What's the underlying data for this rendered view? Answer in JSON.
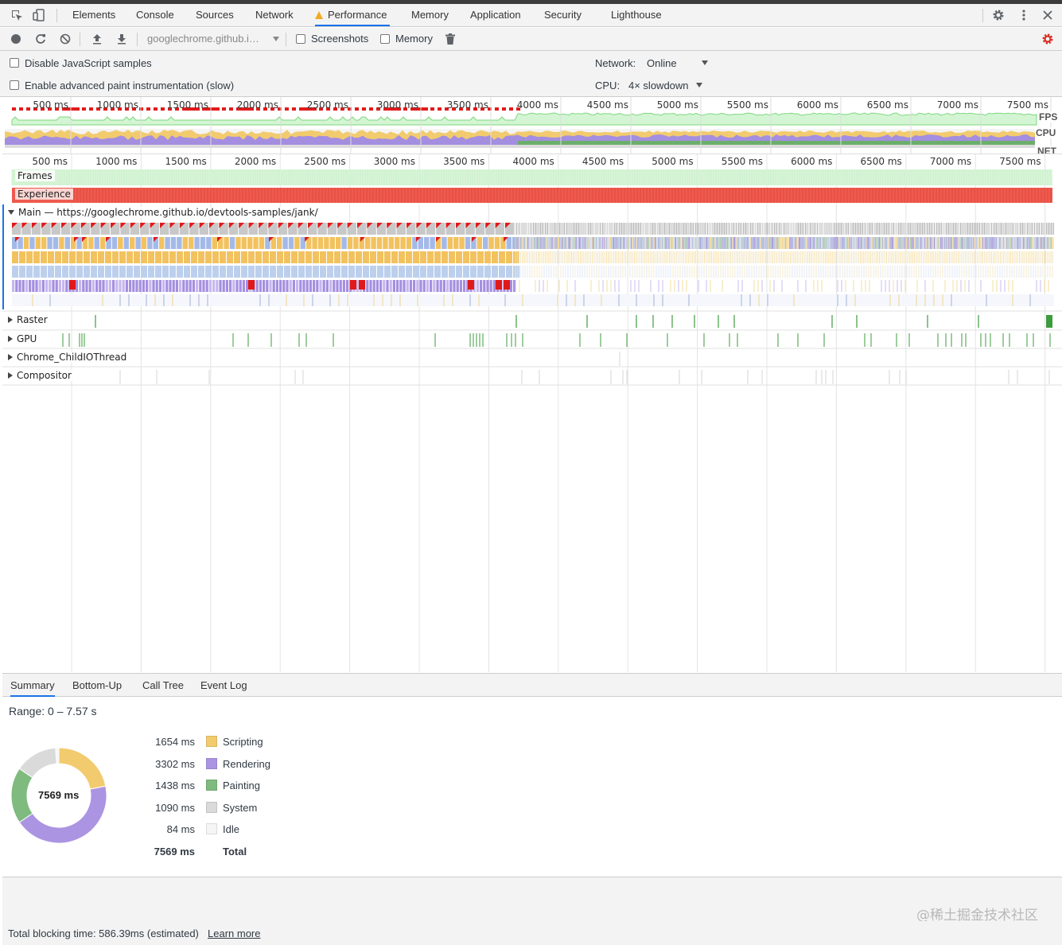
{
  "tabs": [
    {
      "label": "Elements"
    },
    {
      "label": "Console"
    },
    {
      "label": "Sources"
    },
    {
      "label": "Network"
    },
    {
      "label": "Performance"
    },
    {
      "label": "Memory"
    },
    {
      "label": "Application"
    },
    {
      "label": "Security"
    },
    {
      "label": "Lighthouse"
    }
  ],
  "toolbar": {
    "profile_select": "googlechrome.github.i…",
    "screenshots_label": "Screenshots",
    "memory_label": "Memory"
  },
  "settings": {
    "disable_js_samples": "Disable JavaScript samples",
    "advanced_paint": "Enable advanced paint instrumentation (slow)",
    "network_label": "Network:",
    "network_value": "Online",
    "cpu_label": "CPU:",
    "cpu_value": "4× slowdown"
  },
  "overview": {
    "ticks": [
      "500 ms",
      "1000 ms",
      "1500 ms",
      "2000 ms",
      "2500 ms",
      "3000 ms",
      "3500 ms",
      "4000 ms",
      "4500 ms",
      "5000 ms",
      "5500 ms",
      "6000 ms",
      "6500 ms",
      "7000 ms",
      "7500 ms"
    ],
    "labels": {
      "fps": "FPS",
      "cpu": "CPU",
      "net": "NET"
    }
  },
  "timeline": {
    "ticks": [
      "500 ms",
      "1000 ms",
      "1500 ms",
      "2000 ms",
      "2500 ms",
      "3000 ms",
      "3500 ms",
      "4000 ms",
      "4500 ms",
      "5000 ms",
      "5500 ms",
      "6000 ms",
      "6500 ms",
      "7000 ms",
      "7500 ms"
    ],
    "tracks": {
      "frames": "Frames",
      "experience": "Experience",
      "main": "Main — https://googlechrome.github.io/devtools-samples/jank/",
      "raster": "Raster",
      "gpu": "GPU",
      "io": "Chrome_ChildIOThread",
      "compositor": "Compositor"
    }
  },
  "bottom_tabs": [
    {
      "label": "Summary"
    },
    {
      "label": "Bottom-Up"
    },
    {
      "label": "Call Tree"
    },
    {
      "label": "Event Log"
    }
  ],
  "summary": {
    "range": "Range: 0 – 7.57 s",
    "total_center": "7569 ms",
    "rows": [
      {
        "value": "1654 ms",
        "label": "Scripting",
        "color": "#f2cb6f",
        "ms": 1654
      },
      {
        "value": "3302 ms",
        "label": "Rendering",
        "color": "#ab94e2",
        "ms": 3302
      },
      {
        "value": "1438 ms",
        "label": "Painting",
        "color": "#7fba7e",
        "ms": 1438
      },
      {
        "value": "1090 ms",
        "label": "System",
        "color": "#dadada",
        "ms": 1090
      },
      {
        "value": "84 ms",
        "label": "Idle",
        "color": "#f5f5f5",
        "ms": 84
      }
    ],
    "total_value": "7569 ms",
    "total_label": "Total"
  },
  "footer": {
    "blocking": "Total blocking time: 586.39ms (estimated)",
    "learn_more": "Learn more"
  },
  "watermark": "@稀土掘金技术社区"
}
